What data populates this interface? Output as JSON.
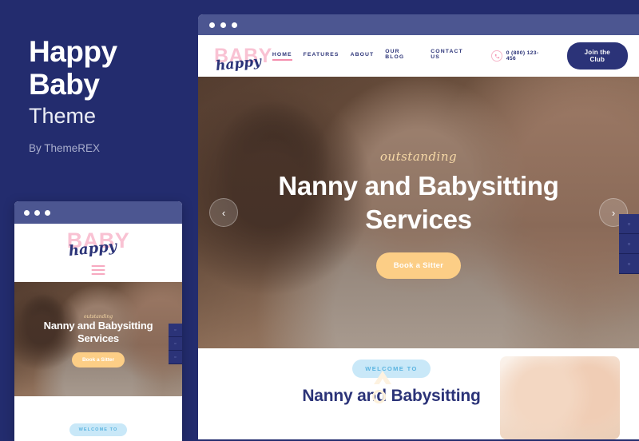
{
  "left_panel": {
    "title_line1": "Happy",
    "title_line2": "Baby",
    "subtitle": "Theme",
    "author": "By ThemeREX"
  },
  "browser": {
    "traffic_lights": 3
  },
  "site": {
    "logo": {
      "primary": "BABY",
      "script": "happy"
    },
    "nav": [
      {
        "label": "HOME",
        "active": true
      },
      {
        "label": "FEATURES",
        "active": false
      },
      {
        "label": "ABOUT",
        "active": false
      },
      {
        "label": "OUR BLOG",
        "active": false
      },
      {
        "label": "CONTACT US",
        "active": false
      }
    ],
    "phone": {
      "icon": "phone-icon",
      "number": "0 (800) 123-456"
    },
    "cta_button": "Join the Club"
  },
  "hero": {
    "script_text": "outstanding",
    "title": "Nanny and Babysitting Services",
    "button": "Book a Sitter",
    "prev_arrow": "‹",
    "next_arrow": "›"
  },
  "social": [
    {
      "name": "facebook-icon",
      "glyph": "▫"
    },
    {
      "name": "twitter-icon",
      "glyph": "▫"
    },
    {
      "name": "instagram-icon",
      "glyph": "▫"
    }
  ],
  "welcome": {
    "badge": "WELCOME TO",
    "title": "Nanny and Babysitting"
  },
  "colors": {
    "page_bg": "#232c6e",
    "navy": "#2b3378",
    "titlebar": "#4c5691",
    "pink": "#f9c2d3",
    "pink_accent": "#f48fae",
    "peach": "#fcce86",
    "light_blue": "#c9e8f8",
    "blue_text": "#5bb4e0",
    "cream": "#f7d9a6"
  }
}
